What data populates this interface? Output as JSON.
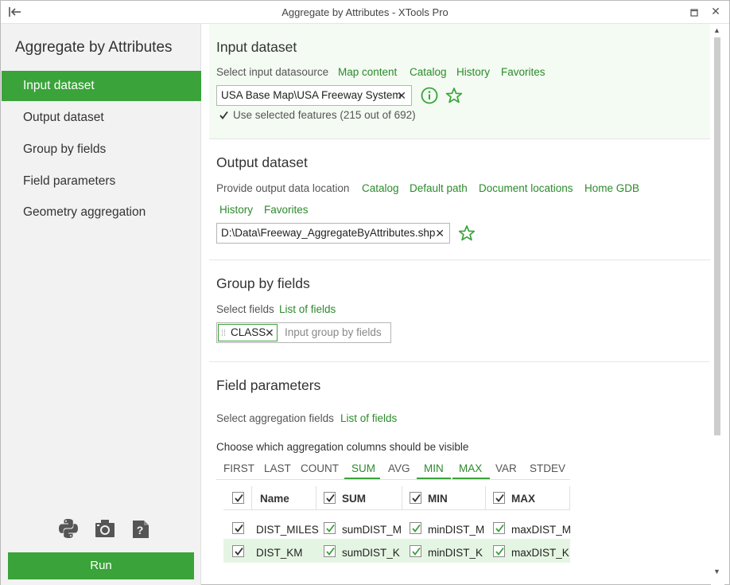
{
  "window": {
    "title": "Aggregate by Attributes - XTools Pro"
  },
  "sidebar": {
    "app_title": "Aggregate by Attributes",
    "items": [
      {
        "label": "Input dataset",
        "active": true
      },
      {
        "label": "Output dataset",
        "active": false
      },
      {
        "label": "Group by fields",
        "active": false
      },
      {
        "label": "Field parameters",
        "active": false
      },
      {
        "label": "Geometry aggregation",
        "active": false
      }
    ],
    "tools": [
      "python-icon",
      "camera-icon",
      "help-icon"
    ],
    "run_label": "Run"
  },
  "input": {
    "title": "Input dataset",
    "label": "Select input datasource",
    "links": [
      "Map content",
      "Catalog",
      "History",
      "Favorites"
    ],
    "value": "USA Base Map\\USA Freeway System",
    "use_selected": "Use selected features (215 out of 692)",
    "use_selected_checked": true
  },
  "output": {
    "title": "Output dataset",
    "label": "Provide output data location",
    "links": [
      "Catalog",
      "Default path",
      "Document locations",
      "Home GDB",
      "History",
      "Favorites"
    ],
    "value": "D:\\Data\\Freeway_AggregateByAttributes.shp"
  },
  "group": {
    "title": "Group by fields",
    "label": "Select fields",
    "link": "List of fields",
    "tag": "CLASS",
    "placeholder": "Input group by fields"
  },
  "fields": {
    "title": "Field parameters",
    "label": "Select aggregation fields",
    "link": "List of fields",
    "columns_label": "Choose which aggregation columns should be visible",
    "tabs": [
      {
        "label": "FIRST",
        "on": false
      },
      {
        "label": "LAST",
        "on": false
      },
      {
        "label": "COUNT",
        "on": false
      },
      {
        "label": "SUM",
        "on": true
      },
      {
        "label": "AVG",
        "on": false
      },
      {
        "label": "MIN",
        "on": true
      },
      {
        "label": "MAX",
        "on": true
      },
      {
        "label": "VAR",
        "on": false
      },
      {
        "label": "STDEV",
        "on": false
      }
    ],
    "headers": {
      "name": "Name",
      "sum": "SUM",
      "min": "MIN",
      "max": "MAX"
    },
    "rows": [
      {
        "name": "DIST_MILES",
        "sum": "sumDIST_M",
        "min": "minDIST_M",
        "max": "maxDIST_M"
      },
      {
        "name": "DIST_KM",
        "sum": "sumDIST_K",
        "min": "minDIST_K",
        "max": "maxDIST_K"
      }
    ]
  },
  "colors": {
    "accent": "#3aa33a",
    "link": "#2c8a2c",
    "active_section_bg": "#f3fbf2",
    "row_bg": "#e5f5e3"
  }
}
